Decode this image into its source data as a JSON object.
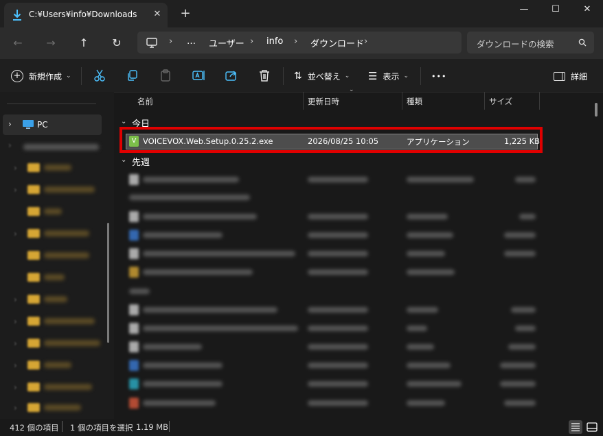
{
  "tab": {
    "title": "C:¥Users¥info¥Downloads",
    "close": "✕",
    "new": "+"
  },
  "window": {
    "minimize": "—",
    "maximize": "☐",
    "close": "✕"
  },
  "address": {
    "crumbs": [
      "…",
      "ユーザー",
      "info",
      "ダウンロード"
    ],
    "separator": "›",
    "search_placeholder": "ダウンロードの検索"
  },
  "commands": {
    "new": "新規作成",
    "sort": "並べ替え",
    "view": "表示",
    "more": "•••",
    "details": "詳細"
  },
  "nav": {
    "pc_label": "PC"
  },
  "columns": {
    "name": "名前",
    "date": "更新日時",
    "type": "種類",
    "size": "サイズ"
  },
  "groups": {
    "today": "今日",
    "last_week": "先週"
  },
  "selected_file": {
    "name": "VOICEVOX.Web.Setup.0.25.2.exe",
    "date": "2026/08/25 10:05",
    "type": "アプリケーション",
    "size": "1,225 KB",
    "icon_letter": "V"
  },
  "status": {
    "items": "412 個の項目",
    "selected": "1 個の項目を選択",
    "selected_size": "1.19 MB"
  },
  "colors": {
    "accent": "#4cc2ff",
    "highlight": "#e00000",
    "folder": "#d6a634"
  }
}
